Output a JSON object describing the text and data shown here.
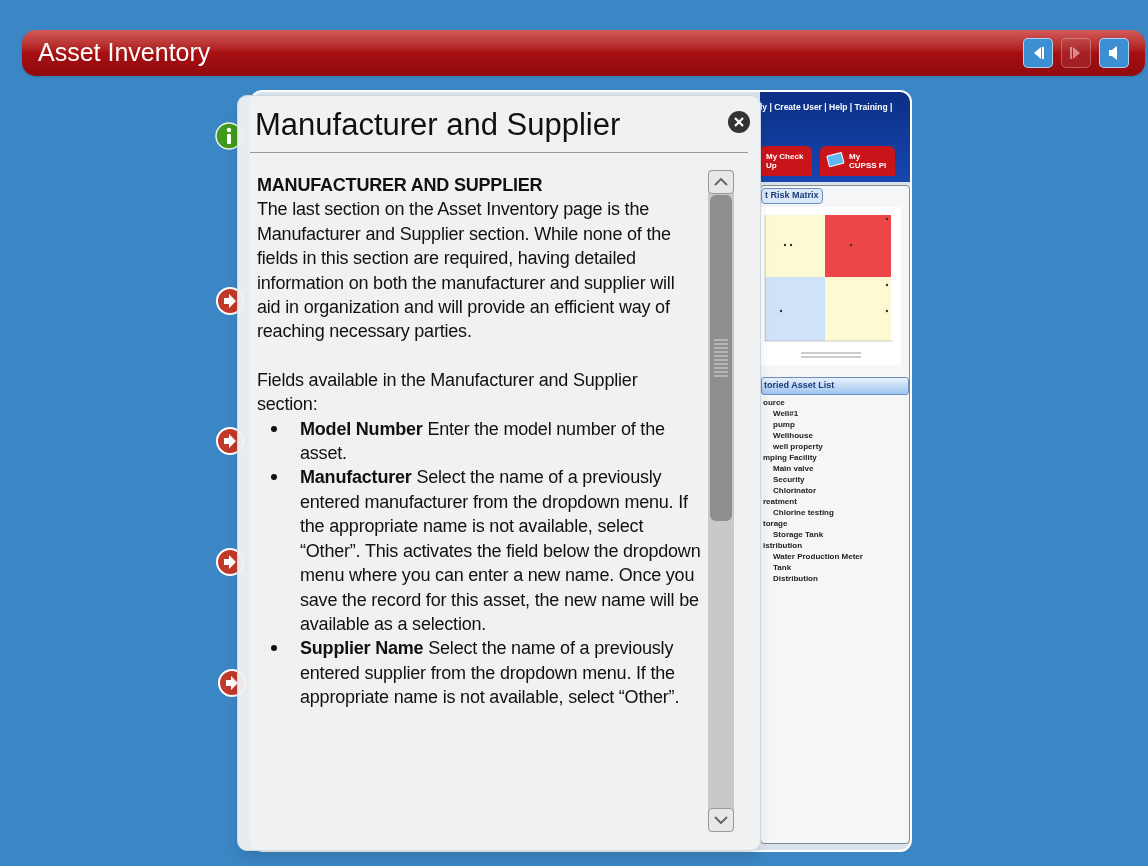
{
  "title_bar": {
    "title": "Asset Inventory",
    "controls": [
      {
        "kind": "back",
        "disabled": false
      },
      {
        "kind": "forward",
        "disabled": true
      },
      {
        "kind": "audio",
        "disabled": false
      }
    ]
  },
  "markers": [
    {
      "kind": "info"
    },
    {
      "kind": "arrow"
    },
    {
      "kind": "arrow"
    },
    {
      "kind": "arrow"
    },
    {
      "kind": "arrow"
    }
  ],
  "app": {
    "header_links": "ly | Create User | Help | Training |",
    "nav_tabs": [
      {
        "label": "My Check Up",
        "selected": false
      },
      {
        "label": "My CUPSS Pl",
        "selected": false
      }
    ],
    "risk_matrix_tab": "t Risk Matrix",
    "asset_list_header": "toried Asset List",
    "tree": [
      {
        "label": "ource",
        "children": [
          {
            "label": "Well#1"
          },
          {
            "label": "pump"
          },
          {
            "label": "Wellhouse"
          },
          {
            "label": "well property"
          }
        ]
      },
      {
        "label": "mping Facility",
        "children": [
          {
            "label": "Main valve"
          },
          {
            "label": "Security"
          },
          {
            "label": "Chlorinator"
          }
        ]
      },
      {
        "label": "reatment",
        "children": [
          {
            "label": "Chlorine testing"
          }
        ]
      },
      {
        "label": "torage",
        "children": [
          {
            "label": "Storage Tank"
          }
        ]
      },
      {
        "label": "istribution",
        "children": [
          {
            "label": "Water Production Meter"
          },
          {
            "label": "Tank"
          },
          {
            "label": "Distribution"
          }
        ]
      }
    ]
  },
  "popup": {
    "title": "Manufacturer and Supplier",
    "heading": "MANUFACTURER AND SUPPLIER",
    "paragraphs": [
      "The last section on the Asset Inventory page is the Manufacturer and Supplier section. While none of the fields in this section are required, having detailed information on both the manufacturer and supplier will aid in organization and will provide an efficient way of reaching necessary parties.",
      "Fields available in the Manufacturer and Supplier section:"
    ],
    "bullets": [
      "**Model Number**  Enter the model number of the asset.",
      "**Manufacturer**  Select the name of a previously entered manufacturer from the dropdown menu. If the appropriate name is not available, select “Other”. This activates the field below the dropdown menu where you can enter a new name.  Once you save the record for this asset, the new name will be available as a selection.",
      "**Supplier Name**  Select the name of a previously entered supplier from the dropdown menu. If the appropriate name is not available, select “Other”."
    ]
  }
}
